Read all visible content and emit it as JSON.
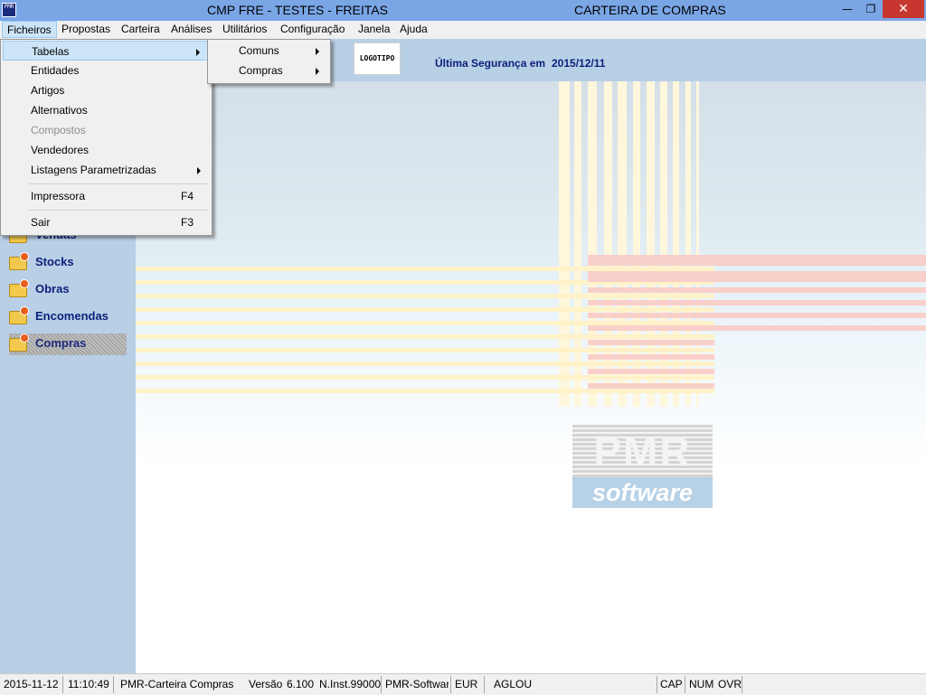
{
  "window": {
    "title_left": "CMP FRE - TESTES - FREITAS",
    "title_right": "CARTEIRA DE COMPRAS",
    "app_icon_text": "PMR",
    "min_glyph": "—",
    "restore_glyph": "❐",
    "close_glyph": "✕"
  },
  "menubar": {
    "items": [
      "Ficheiros",
      "Propostas",
      "Carteira",
      "Análises",
      "Utilitários",
      "Configuração",
      "Janela",
      "Ajuda"
    ]
  },
  "ficheiros_menu": {
    "items": [
      {
        "label": "Tabelas",
        "submenu": true
      },
      {
        "label": "Entidades"
      },
      {
        "label": "Artigos"
      },
      {
        "label": "Alternativos"
      },
      {
        "label": "Compostos",
        "disabled": true
      },
      {
        "label": "Vendedores"
      },
      {
        "label": "Listagens Parametrizadas",
        "submenu": true
      },
      {
        "label": "Impressora",
        "shortcut": "F4"
      },
      {
        "label": "Sair",
        "shortcut": "F3"
      }
    ]
  },
  "tabelas_submenu": {
    "items": [
      {
        "label": "Comuns",
        "submenu": true
      },
      {
        "label": "Compras",
        "submenu": true
      }
    ]
  },
  "header": {
    "logo_text": "LOGOTIPO",
    "backup_label": "Última Segurança em",
    "backup_date": "2015/12/11"
  },
  "sidebar": {
    "items": [
      {
        "label": "Vendas"
      },
      {
        "label": "Stocks"
      },
      {
        "label": "Obras"
      },
      {
        "label": "Encomendas"
      },
      {
        "label": "Compras",
        "selected": true
      }
    ]
  },
  "brand": {
    "top": "PMR",
    "bottom": "software"
  },
  "statusbar": {
    "date": "2015-11-12",
    "time": "11:10:49",
    "app": "PMR-Carteira Compras",
    "version_label": "Versão",
    "version": "6.100",
    "install": "N.Inst.99000",
    "company": "PMR-Software",
    "currency": "EUR",
    "user": "AGLOU",
    "cap": "CAP",
    "num": "NUM",
    "ovr": "OVR"
  },
  "colors": {
    "titlebar": "#7aa6e6",
    "sidebar": "#b8cfe6",
    "accent_text": "#0a1f7a",
    "close_button": "#c7372f"
  }
}
